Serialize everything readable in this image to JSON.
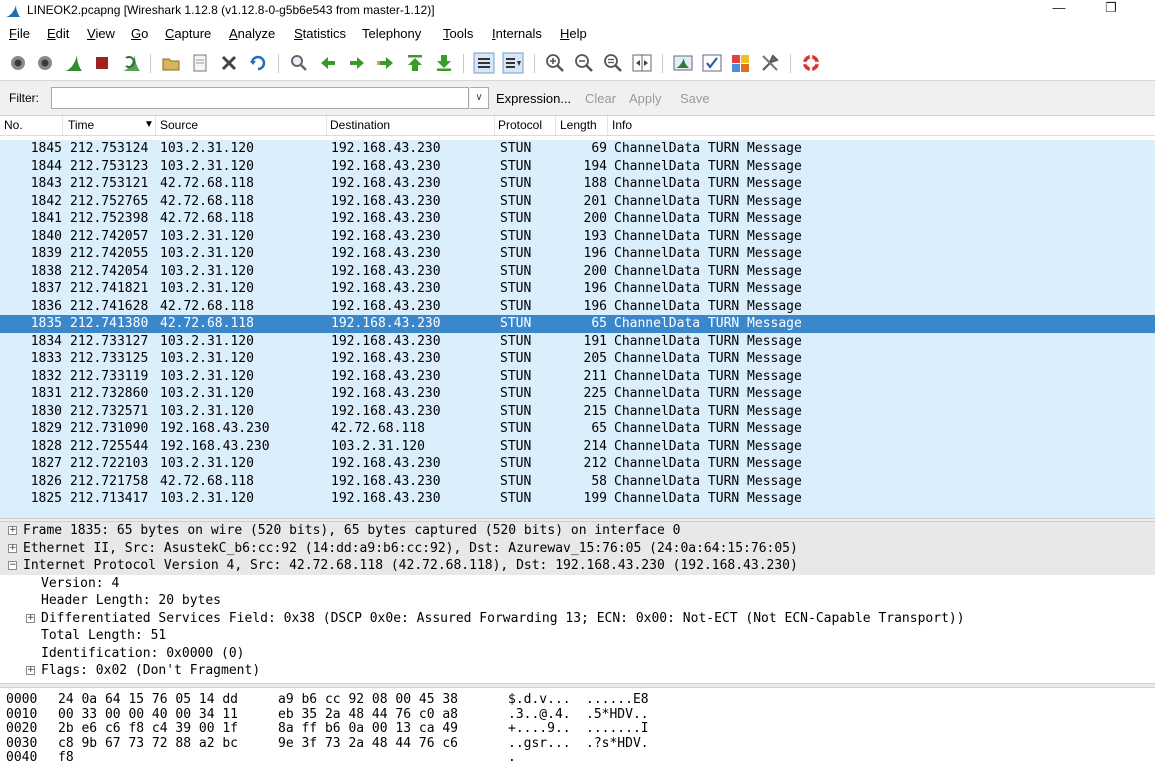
{
  "window": {
    "title": "LINEOK2.pcapng  [Wireshark 1.12.8  (v1.12.8-0-g5b6e543 from master-1.12)]",
    "minimize_glyph": "—",
    "maximize_glyph": "❐"
  },
  "menu": [
    {
      "u": "F",
      "rest": "ile"
    },
    {
      "u": "E",
      "rest": "dit"
    },
    {
      "u": "V",
      "rest": "iew"
    },
    {
      "u": "G",
      "rest": "o"
    },
    {
      "u": "C",
      "rest": "apture"
    },
    {
      "u": "A",
      "rest": "nalyze"
    },
    {
      "u": "S",
      "rest": "tatistics"
    },
    {
      "u": "",
      "rest": "Telephony"
    },
    {
      "u": "T",
      "rest": "ools"
    },
    {
      "u": "I",
      "rest": "nternals"
    },
    {
      "u": "H",
      "rest": "elp"
    }
  ],
  "filter": {
    "label": "Filter:",
    "value": "",
    "expression": "Expression...",
    "clear": "Clear",
    "apply": "Apply",
    "save": "Save"
  },
  "columns": {
    "no": "No.",
    "time": "Time",
    "source": "Source",
    "destination": "Destination",
    "protocol": "Protocol",
    "length": "Length",
    "info": "Info"
  },
  "sort_indicator": "▼",
  "packets": [
    {
      "no": "1845",
      "time": "212.753124",
      "src": "103.2.31.120",
      "dst": "192.168.43.230",
      "proto": "STUN",
      "len": "69",
      "info": "ChannelData TURN Message"
    },
    {
      "no": "1844",
      "time": "212.753123",
      "src": "103.2.31.120",
      "dst": "192.168.43.230",
      "proto": "STUN",
      "len": "194",
      "info": "ChannelData TURN Message"
    },
    {
      "no": "1843",
      "time": "212.753121",
      "src": "42.72.68.118",
      "dst": "192.168.43.230",
      "proto": "STUN",
      "len": "188",
      "info": "ChannelData TURN Message"
    },
    {
      "no": "1842",
      "time": "212.752765",
      "src": "42.72.68.118",
      "dst": "192.168.43.230",
      "proto": "STUN",
      "len": "201",
      "info": "ChannelData TURN Message"
    },
    {
      "no": "1841",
      "time": "212.752398",
      "src": "42.72.68.118",
      "dst": "192.168.43.230",
      "proto": "STUN",
      "len": "200",
      "info": "ChannelData TURN Message"
    },
    {
      "no": "1840",
      "time": "212.742057",
      "src": "103.2.31.120",
      "dst": "192.168.43.230",
      "proto": "STUN",
      "len": "193",
      "info": "ChannelData TURN Message"
    },
    {
      "no": "1839",
      "time": "212.742055",
      "src": "103.2.31.120",
      "dst": "192.168.43.230",
      "proto": "STUN",
      "len": "196",
      "info": "ChannelData TURN Message"
    },
    {
      "no": "1838",
      "time": "212.742054",
      "src": "103.2.31.120",
      "dst": "192.168.43.230",
      "proto": "STUN",
      "len": "200",
      "info": "ChannelData TURN Message"
    },
    {
      "no": "1837",
      "time": "212.741821",
      "src": "103.2.31.120",
      "dst": "192.168.43.230",
      "proto": "STUN",
      "len": "196",
      "info": "ChannelData TURN Message"
    },
    {
      "no": "1836",
      "time": "212.741628",
      "src": "42.72.68.118",
      "dst": "192.168.43.230",
      "proto": "STUN",
      "len": "196",
      "info": "ChannelData TURN Message"
    },
    {
      "no": "1835",
      "time": "212.741380",
      "src": "42.72.68.118",
      "dst": "192.168.43.230",
      "proto": "STUN",
      "len": "65",
      "info": "ChannelData TURN Message",
      "selected": true
    },
    {
      "no": "1834",
      "time": "212.733127",
      "src": "103.2.31.120",
      "dst": "192.168.43.230",
      "proto": "STUN",
      "len": "191",
      "info": "ChannelData TURN Message"
    },
    {
      "no": "1833",
      "time": "212.733125",
      "src": "103.2.31.120",
      "dst": "192.168.43.230",
      "proto": "STUN",
      "len": "205",
      "info": "ChannelData TURN Message"
    },
    {
      "no": "1832",
      "time": "212.733119",
      "src": "103.2.31.120",
      "dst": "192.168.43.230",
      "proto": "STUN",
      "len": "211",
      "info": "ChannelData TURN Message"
    },
    {
      "no": "1831",
      "time": "212.732860",
      "src": "103.2.31.120",
      "dst": "192.168.43.230",
      "proto": "STUN",
      "len": "225",
      "info": "ChannelData TURN Message"
    },
    {
      "no": "1830",
      "time": "212.732571",
      "src": "103.2.31.120",
      "dst": "192.168.43.230",
      "proto": "STUN",
      "len": "215",
      "info": "ChannelData TURN Message"
    },
    {
      "no": "1829",
      "time": "212.731090",
      "src": "192.168.43.230",
      "dst": "42.72.68.118",
      "proto": "STUN",
      "len": "65",
      "info": "ChannelData TURN Message"
    },
    {
      "no": "1828",
      "time": "212.725544",
      "src": "192.168.43.230",
      "dst": "103.2.31.120",
      "proto": "STUN",
      "len": "214",
      "info": "ChannelData TURN Message"
    },
    {
      "no": "1827",
      "time": "212.722103",
      "src": "103.2.31.120",
      "dst": "192.168.43.230",
      "proto": "STUN",
      "len": "212",
      "info": "ChannelData TURN Message"
    },
    {
      "no": "1826",
      "time": "212.721758",
      "src": "42.72.68.118",
      "dst": "192.168.43.230",
      "proto": "STUN",
      "len": "58",
      "info": "ChannelData TURN Message"
    },
    {
      "no": "1825",
      "time": "212.713417",
      "src": "103.2.31.120",
      "dst": "192.168.43.230",
      "proto": "STUN",
      "len": "199",
      "info": "ChannelData TURN Message"
    }
  ],
  "details": [
    {
      "indent": 0,
      "exp": "+",
      "text": "Frame 1835: 65 bytes on wire (520 bits), 65 bytes captured (520 bits) on interface 0",
      "hl": true
    },
    {
      "indent": 0,
      "exp": "+",
      "text": "Ethernet II, Src: AsustekC_b6:cc:92 (14:dd:a9:b6:cc:92), Dst: Azurewav_15:76:05 (24:0a:64:15:76:05)",
      "hl": true
    },
    {
      "indent": 0,
      "exp": "-",
      "text": "Internet Protocol Version 4, Src: 42.72.68.118 (42.72.68.118), Dst: 192.168.43.230 (192.168.43.230)",
      "hl": true
    },
    {
      "indent": 1,
      "exp": "",
      "text": "Version: 4"
    },
    {
      "indent": 1,
      "exp": "",
      "text": "Header Length: 20 bytes"
    },
    {
      "indent": 1,
      "exp": "+",
      "text": "Differentiated Services Field: 0x38 (DSCP 0x0e: Assured Forwarding 13; ECN: 0x00: Not-ECT (Not ECN-Capable Transport))"
    },
    {
      "indent": 1,
      "exp": "",
      "text": "Total Length: 51"
    },
    {
      "indent": 1,
      "exp": "",
      "text": "Identification: 0x0000 (0)"
    },
    {
      "indent": 1,
      "exp": "+",
      "text": "Flags: 0x02 (Don't Fragment)"
    }
  ],
  "bytes": [
    {
      "off": "0000",
      "hex1": "24 0a 64 15 76 05 14 dd",
      "hex2": "a9 b6 cc 92 08 00 45 38",
      "asc1": "$.d.v...",
      "asc2": "......E8"
    },
    {
      "off": "0010",
      "hex1": "00 33 00 00 40 00 34 11",
      "hex2": "eb 35 2a 48 44 76 c0 a8",
      "asc1": ".3..@.4.",
      "asc2": ".5*HDV.."
    },
    {
      "off": "0020",
      "hex1": "2b e6 c6 f8 c4 39 00 1f",
      "hex2": "8a ff b6 0a 00 13 ca 49",
      "asc1": "+....9..",
      "asc2": ".......I"
    },
    {
      "off": "0030",
      "hex1": "c8 9b 67 73 72 88 a2 bc",
      "hex2": "9e 3f 73 2a 48 44 76 c6",
      "asc1": "..gsr...",
      "asc2": ".?s*HDV."
    },
    {
      "off": "0040",
      "hex1": "f8",
      "hex2": "",
      "asc1": ".",
      "asc2": ""
    }
  ]
}
